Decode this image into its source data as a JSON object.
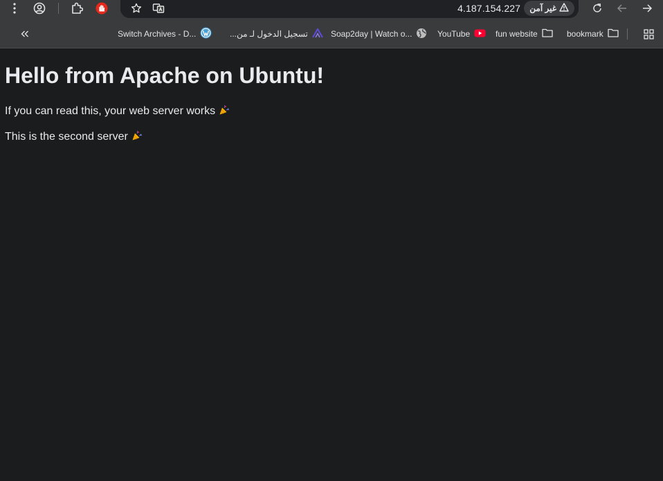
{
  "toolbar": {
    "url": "4.187.154.227",
    "security_label": "غير آمن",
    "icons": [
      "menu-dots-icon",
      "profile-icon",
      "extensions-icon",
      "adblock-extension-icon",
      "bookmark-star-icon",
      "translate-icon",
      "reload-icon",
      "back-icon",
      "forward-icon"
    ]
  },
  "bookmarks": {
    "items": [
      {
        "label": "bookmark",
        "icon": "folder-icon"
      },
      {
        "label": "fun website",
        "icon": "folder-icon"
      },
      {
        "label": "YouTube",
        "icon": "youtube-icon"
      },
      {
        "label": "Soap2day | Watch o...",
        "icon": "globe-icon"
      },
      {
        "label": "تسجيل الدخول لـ من...",
        "icon": "site-logo-icon"
      },
      {
        "label": "Switch Archives - D...",
        "icon": "wordpress-icon"
      }
    ]
  },
  "page": {
    "heading": "Hello from Apache on Ubuntu!",
    "line1": "If you can read this, your web server works",
    "line2": "This is the second server",
    "emoji": "🎉"
  },
  "colors": {
    "toolbar_bg": "#3a3b3d",
    "omnibox_bg": "#202124",
    "page_bg": "#1b1c1e",
    "text": "#e8eaed",
    "youtube_red": "#ff0033",
    "wordpress_blue": "#4a9fd5",
    "adblock_red": "#e5281a"
  }
}
